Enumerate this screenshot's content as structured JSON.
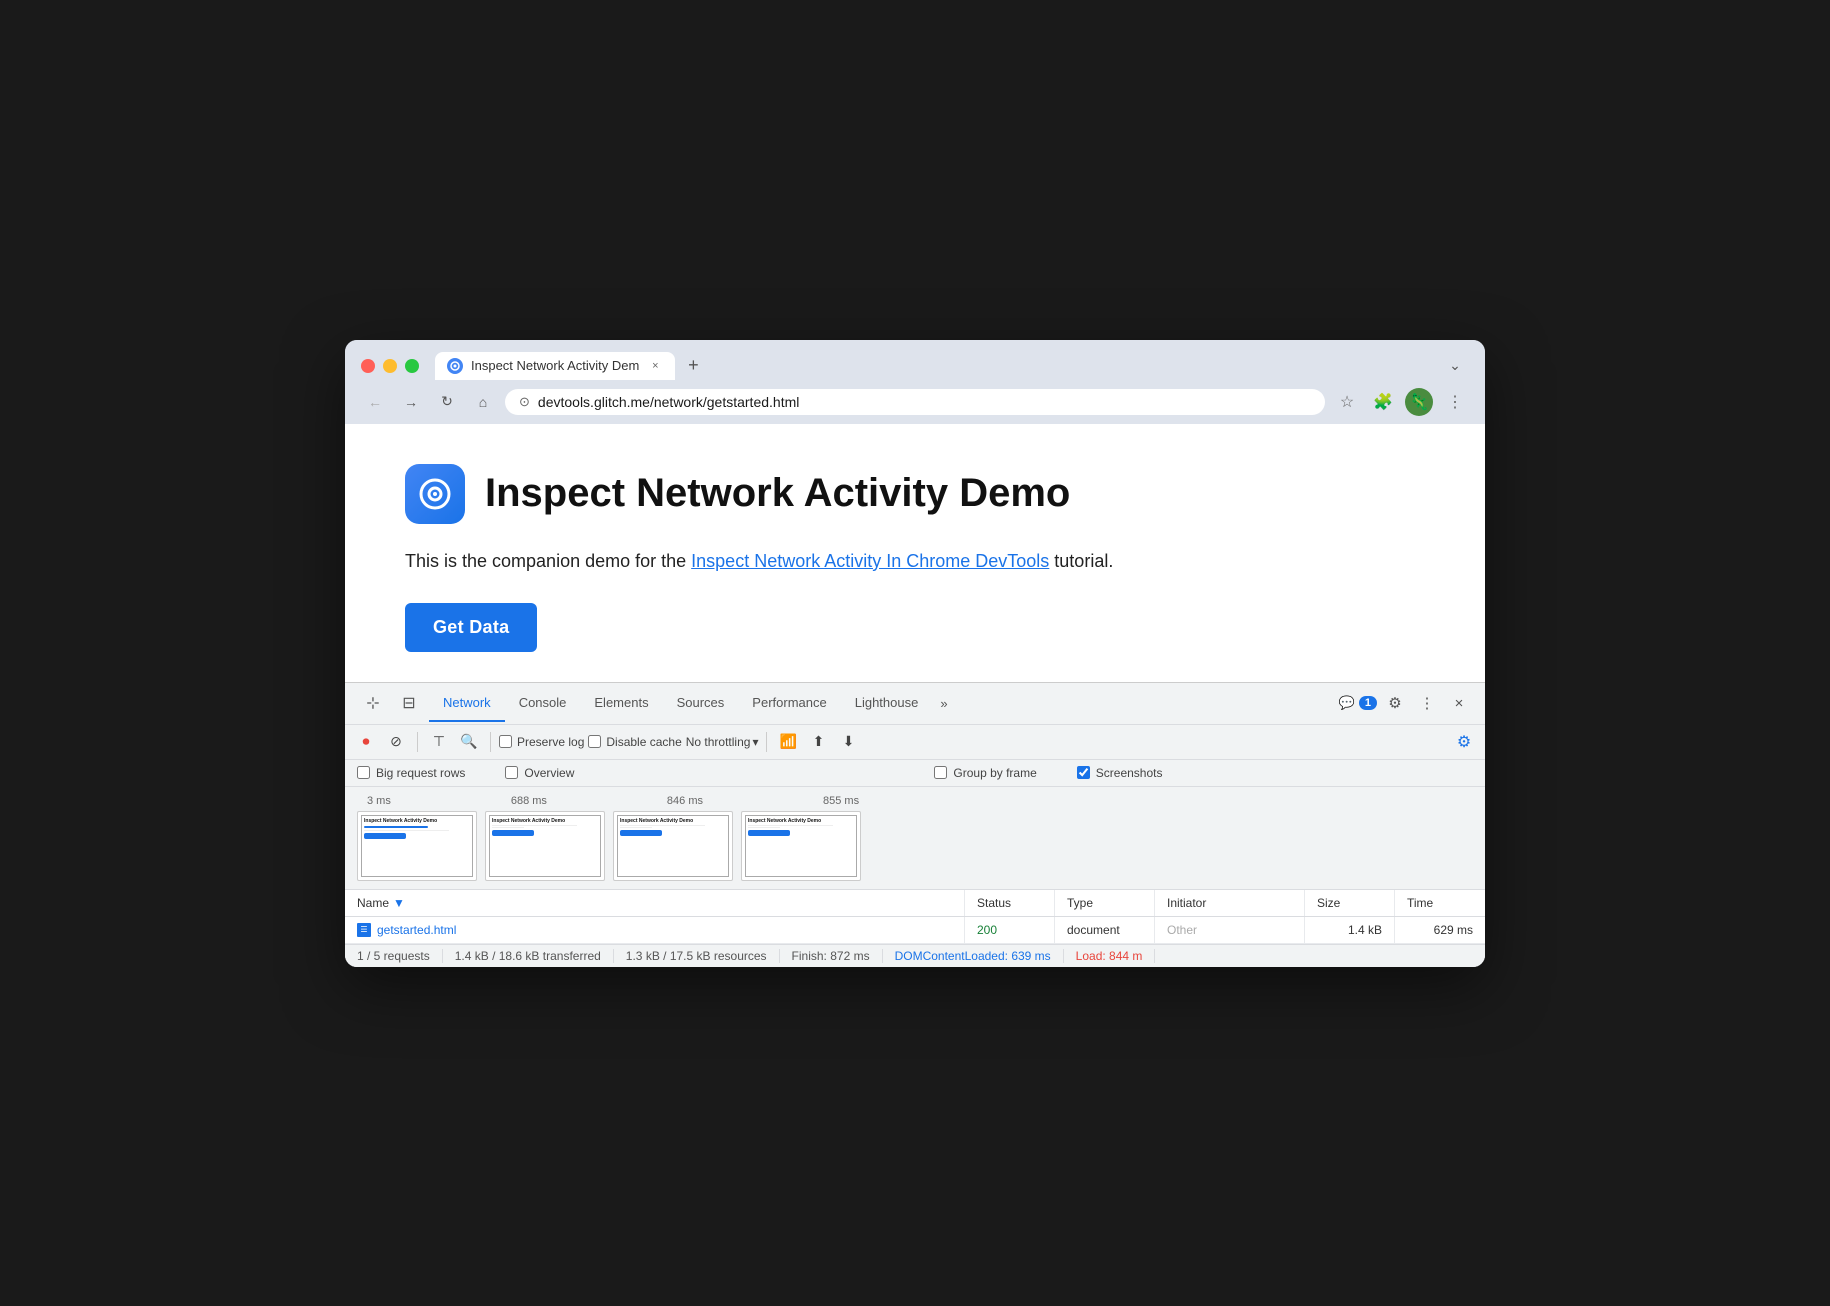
{
  "browser": {
    "traffic_lights": {
      "red": "#ff5f57",
      "yellow": "#febc2e",
      "green": "#28c840"
    },
    "tab": {
      "title": "Inspect Network Activity Dem",
      "close_label": "×",
      "new_tab_label": "+"
    },
    "expand_label": "⌄",
    "nav": {
      "back_label": "←",
      "forward_label": "→",
      "reload_label": "↻",
      "home_label": "⌂"
    },
    "address": {
      "tracking_icon": "⊙",
      "url": "devtools.glitch.me/network/getstarted.html",
      "bookmark_icon": "☆",
      "extensions_icon": "🧩",
      "profile_emoji": "🦎",
      "menu_icon": "⋮"
    }
  },
  "page": {
    "title": "Inspect Network Activity Demo",
    "subtitle_pre": "This is the companion demo for the ",
    "subtitle_link": "Inspect Network Activity In Chrome DevTools",
    "subtitle_post": " tutorial.",
    "get_data_btn": "Get Data"
  },
  "devtools": {
    "tools": {
      "cursor_icon": "⊹",
      "layers_icon": "⊟"
    },
    "tabs": [
      {
        "label": "Network",
        "active": true
      },
      {
        "label": "Console",
        "active": false
      },
      {
        "label": "Elements",
        "active": false
      },
      {
        "label": "Sources",
        "active": false
      },
      {
        "label": "Performance",
        "active": false
      },
      {
        "label": "Lighthouse",
        "active": false
      },
      {
        "label": "»",
        "active": false
      }
    ],
    "badge": "1",
    "right_buttons": {
      "settings_label": "⚙",
      "more_label": "⋮",
      "close_label": "×"
    },
    "toolbar": {
      "record_btn": "⏺",
      "clear_btn": "⊘",
      "filter_btn": "⊤",
      "search_btn": "🔍",
      "preserve_log_label": "Preserve log",
      "disable_cache_label": "Disable cache",
      "throttle_label": "No throttling",
      "throttle_arrow": "▾",
      "wifi_icon": "📶",
      "upload_icon": "⬆",
      "download_icon": "⬇",
      "settings_icon": "⚙"
    },
    "options": {
      "big_rows_label": "Big request rows",
      "big_rows_checked": false,
      "overview_label": "Overview",
      "overview_checked": false,
      "group_by_frame_label": "Group by frame",
      "group_by_frame_checked": false,
      "screenshots_label": "Screenshots",
      "screenshots_checked": true
    },
    "timeline": {
      "timestamps": [
        "3 ms",
        "688 ms",
        "846 ms",
        "855 ms"
      ]
    },
    "table": {
      "columns": [
        "Name",
        "▼",
        "Status",
        "Type",
        "Initiator",
        "Size",
        "Time"
      ],
      "rows": [
        {
          "name": "getstarted.html",
          "status": "200",
          "type": "document",
          "initiator": "Other",
          "size": "1.4 kB",
          "time": "629 ms"
        }
      ]
    },
    "statusbar": {
      "requests": "1 / 5 requests",
      "transferred": "1.4 kB / 18.6 kB transferred",
      "resources": "1.3 kB / 17.5 kB resources",
      "finish": "Finish: 872 ms",
      "dom_content_loaded": "DOMContentLoaded: 639 ms",
      "load": "Load: 844 m"
    }
  }
}
